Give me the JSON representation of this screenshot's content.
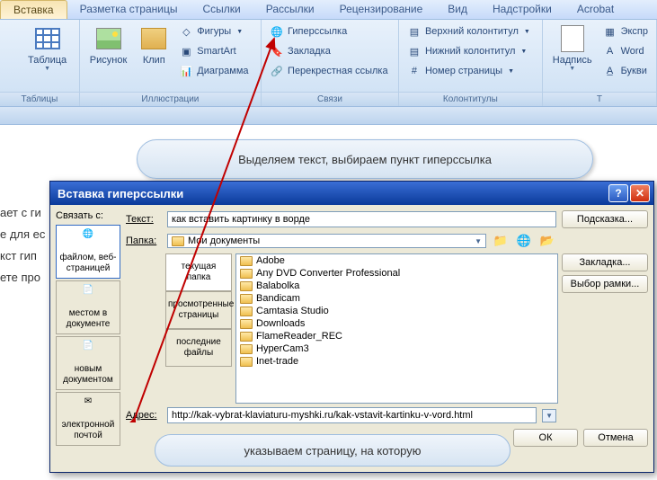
{
  "tabs": [
    "Вставка",
    "Разметка страницы",
    "Ссылки",
    "Рассылки",
    "Рецензирование",
    "Вид",
    "Надстройки",
    "Acrobat"
  ],
  "groups": {
    "tables": {
      "label": "Таблицы",
      "table": "Таблица"
    },
    "illustrations": {
      "label": "Иллюстрации",
      "pic": "Рисунок",
      "clip": "Клип",
      "shapes": "Фигуры",
      "smartart": "SmartArt",
      "chart": "Диаграмма"
    },
    "links": {
      "label": "Связи",
      "hyperlink": "Гиперссылка",
      "bookmark": "Закладка",
      "crossref": "Перекрестная ссылка"
    },
    "headerfooter": {
      "label": "Колонтитулы",
      "header": "Верхний колонтитул",
      "footer": "Нижний колонтитул",
      "pagenum": "Номер страницы"
    },
    "text": {
      "label": "Т",
      "textbox": "Надпись",
      "express": "Экспр",
      "wordart": "Word",
      "dropcap": "Букви"
    }
  },
  "doc_lines": [
    "ает с ги",
    "е для ес",
    "кст гип",
    "ете про"
  ],
  "callout1": "Выделяем текст, выбираем пункт гиперссылка",
  "callout2": "указываем страницу, на которую",
  "dialog": {
    "title": "Вставка гиперссылки",
    "linkto_label": "Связать с:",
    "linkto": {
      "file": "файлом, веб-страницей",
      "place": "местом в документе",
      "newdoc": "новым документом",
      "email": "электронной почтой"
    },
    "text_label": "Текст:",
    "text_value": "как вставить картинку в ворде",
    "folder_label": "Папка:",
    "folder_value": "Мои документы",
    "subnav": {
      "current": "текущая папка",
      "viewed": "просмотренные страницы",
      "recent": "последние файлы"
    },
    "files": [
      "Adobe",
      "Any DVD Converter Professional",
      "Balabolka",
      "Bandicam",
      "Camtasia Studio",
      "Downloads",
      "FlameReader_REC",
      "HyperCam3",
      "Inet-trade"
    ],
    "address_label": "Адрес:",
    "address_value": "http://kak-vybrat-klaviaturu-myshki.ru/kak-vstavit-kartinku-v-vord.html",
    "btn_hint": "Подсказка...",
    "btn_bookmark": "Закладка...",
    "btn_frame": "Выбор рамки...",
    "btn_ok": "ОК",
    "btn_cancel": "Отмена"
  }
}
